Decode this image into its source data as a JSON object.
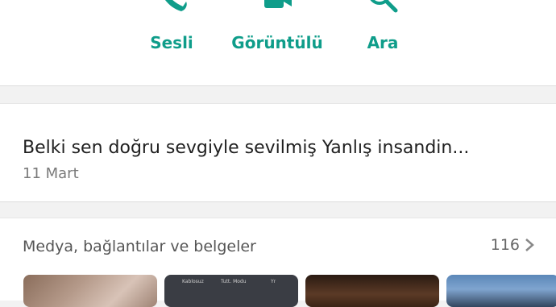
{
  "actions": [
    {
      "label": "Sesli",
      "icon": "phone-icon"
    },
    {
      "label": "Görüntülü",
      "icon": "video-camera-icon"
    },
    {
      "label": "Ara",
      "icon": "search-icon"
    }
  ],
  "status": {
    "text": "Belki sen doğru sevgiyle sevilmiş Yanlış insandin...",
    "date": "11 Mart"
  },
  "media": {
    "title": "Medya, bağlantılar ve belgeler",
    "count": "116",
    "thumb2_labels": [
      "Kablosuz",
      "Tutt. Modu",
      "Yr"
    ]
  },
  "colors": {
    "accent": "#0f9d8a",
    "background": "#f2f2f2",
    "card": "#ffffff"
  }
}
